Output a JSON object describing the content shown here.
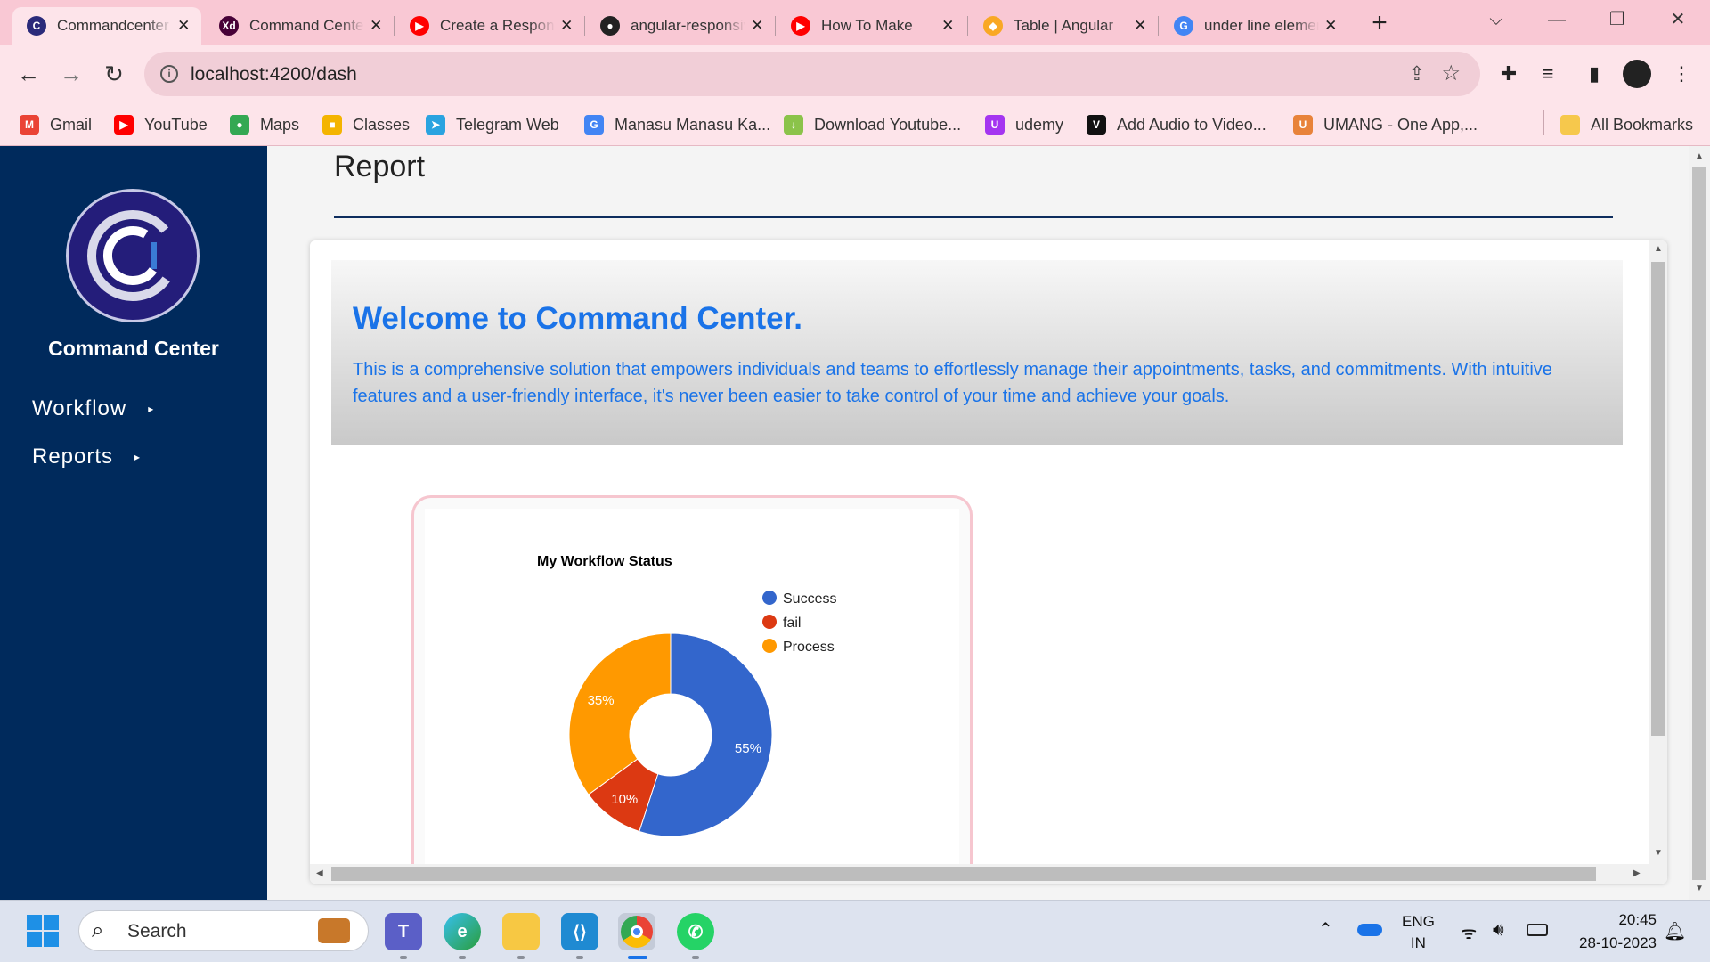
{
  "browser": {
    "tabs": [
      {
        "title": "Commandcenter",
        "icon": "command-center-favicon",
        "color": "#2b2a7a",
        "glyph": "C",
        "active": true
      },
      {
        "title": "Command Center",
        "icon": "adobe-xd-favicon",
        "color": "#470137",
        "glyph": "Xd"
      },
      {
        "title": "Create a Responsive",
        "icon": "youtube-favicon",
        "color": "#ff0000",
        "glyph": "▶"
      },
      {
        "title": "angular-responsive",
        "icon": "github-favicon",
        "color": "#222222",
        "glyph": "●"
      },
      {
        "title": "How To Make",
        "icon": "youtube-favicon",
        "color": "#ff0000",
        "glyph": "▶"
      },
      {
        "title": "Table | Angular",
        "icon": "angular-material-favicon",
        "color": "#f9a825",
        "glyph": "◆"
      },
      {
        "title": "under line element",
        "icon": "google-favicon",
        "color": "#4285f4",
        "glyph": "G"
      }
    ],
    "url": "localhost:4200/dash",
    "bookmarks": [
      {
        "label": "Gmail",
        "icon": "gmail-icon",
        "color": "#ea4335",
        "glyph": "M"
      },
      {
        "label": "YouTube",
        "icon": "youtube-icon",
        "color": "#ff0000",
        "glyph": "▶"
      },
      {
        "label": "Maps",
        "icon": "maps-icon",
        "color": "#34a853",
        "glyph": "●"
      },
      {
        "label": "Classes",
        "icon": "classroom-icon",
        "color": "#f4b400",
        "glyph": "■"
      },
      {
        "label": "Telegram Web",
        "icon": "telegram-icon",
        "color": "#2aa3e0",
        "glyph": "➤"
      },
      {
        "label": "Manasu Manasu Ka...",
        "icon": "google-icon",
        "color": "#4285f4",
        "glyph": "G"
      },
      {
        "label": "Download Youtube...",
        "icon": "download-icon",
        "color": "#8bc34a",
        "glyph": "↓"
      },
      {
        "label": "udemy",
        "icon": "udemy-icon",
        "color": "#a435f0",
        "glyph": "U"
      },
      {
        "label": "Add Audio to Video...",
        "icon": "v-icon",
        "color": "#111111",
        "glyph": "V"
      },
      {
        "label": "UMANG - One App,...",
        "icon": "umang-icon",
        "color": "#e8833a",
        "glyph": "U"
      }
    ],
    "all_bookmarks": "All Bookmarks"
  },
  "sidebar": {
    "brand": "Command Center",
    "items": [
      {
        "label": "Workflow",
        "arrow": "▸"
      },
      {
        "label": "Reports",
        "arrow": "▸"
      }
    ]
  },
  "main": {
    "page_title": "Report",
    "welcome_title": "Welcome to Command Center.",
    "welcome_text": "This is a comprehensive solution that empowers individuals and teams to effortlessly manage their appointments, tasks, and commitments. With intuitive features and a user-friendly interface, it's never been easier to take control of your time and achieve your goals."
  },
  "chart_data": {
    "type": "pie",
    "donut": true,
    "title": "My Workflow Status",
    "legend_position": "right",
    "slices": [
      {
        "label": "Success",
        "value": 55,
        "color": "#3366cc"
      },
      {
        "label": "fail",
        "value": 10,
        "color": "#dc3912"
      },
      {
        "label": "Process",
        "value": 35,
        "color": "#ff9900"
      }
    ],
    "value_labels": [
      "55%",
      "10%",
      "35%"
    ]
  },
  "taskbar": {
    "search_placeholder": "Search",
    "language": "ENG",
    "region": "IN",
    "time": "20:45",
    "date": "28-10-2023"
  }
}
